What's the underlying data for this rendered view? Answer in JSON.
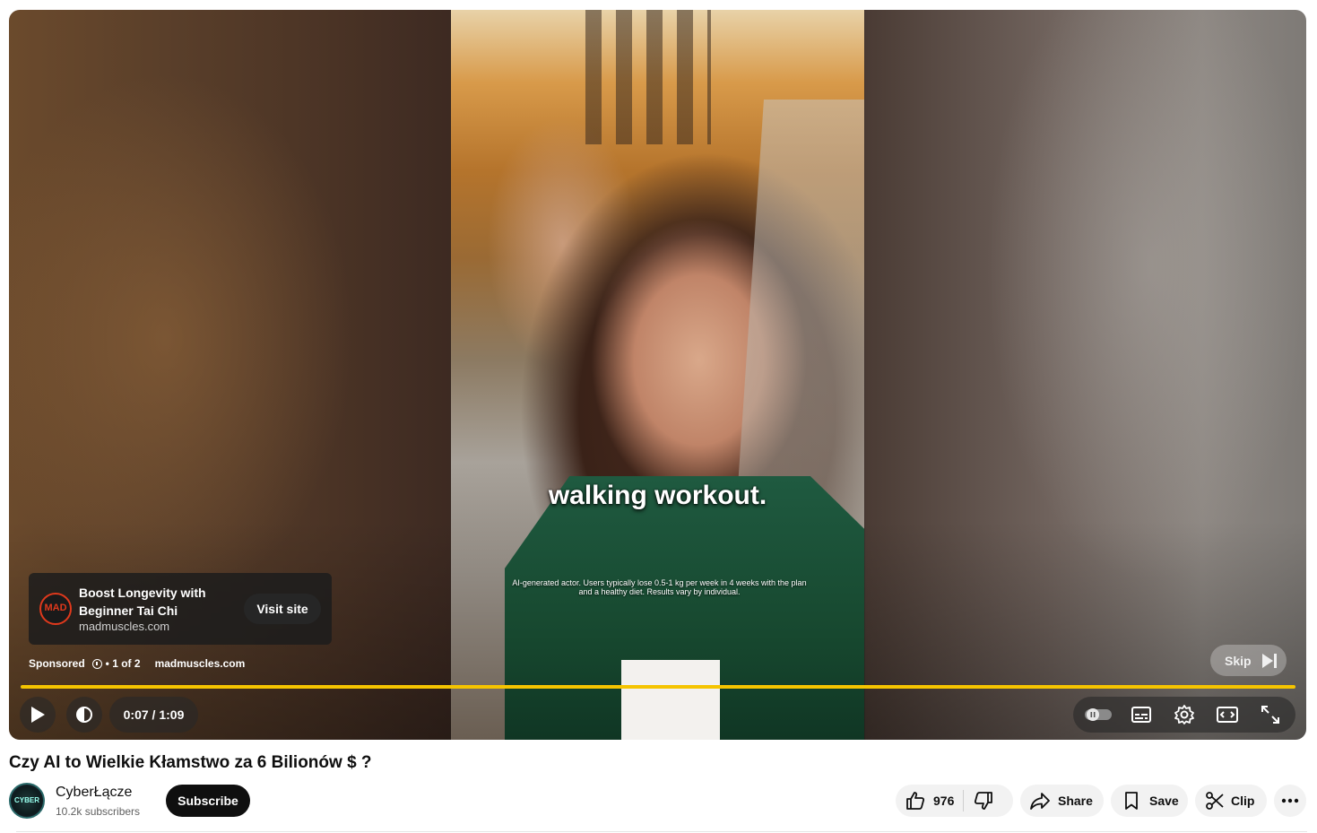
{
  "player": {
    "caption_main": "walking workout.",
    "caption_disclaimer": "AI-generated actor. Users typically lose 0.5-1 kg per week in 4 weeks with the plan and a healthy diet. Results vary by individual.",
    "progress_fraction": 1.0,
    "ad": {
      "logo_text": "MAD",
      "title": "Boost Longevity with Beginner Tai Chi",
      "domain": "madmuscles.com",
      "visit_label": "Visit site"
    },
    "sponsored": {
      "label": "Sponsored",
      "count": "• 1 of 2",
      "domain": "madmuscles.com"
    },
    "skip_label": "Skip",
    "time": "0:07 / 1:09",
    "accent_color": "#f5c400",
    "icons": [
      "play-icon",
      "volume-icon",
      "autoplay-toggle-icon",
      "subtitles-icon",
      "settings-icon",
      "theater-mode-icon",
      "fullscreen-icon"
    ]
  },
  "video": {
    "title": "Czy AI to Wielkie Kłamstwo za 6 Bilionów $ ?"
  },
  "channel": {
    "avatar_text": "CYBER",
    "name": "CyberŁącze",
    "subscribers": "10.2k subscribers",
    "subscribe_label": "Subscribe"
  },
  "actions": {
    "like_count": "976",
    "share_label": "Share",
    "save_label": "Save",
    "clip_label": "Clip"
  }
}
